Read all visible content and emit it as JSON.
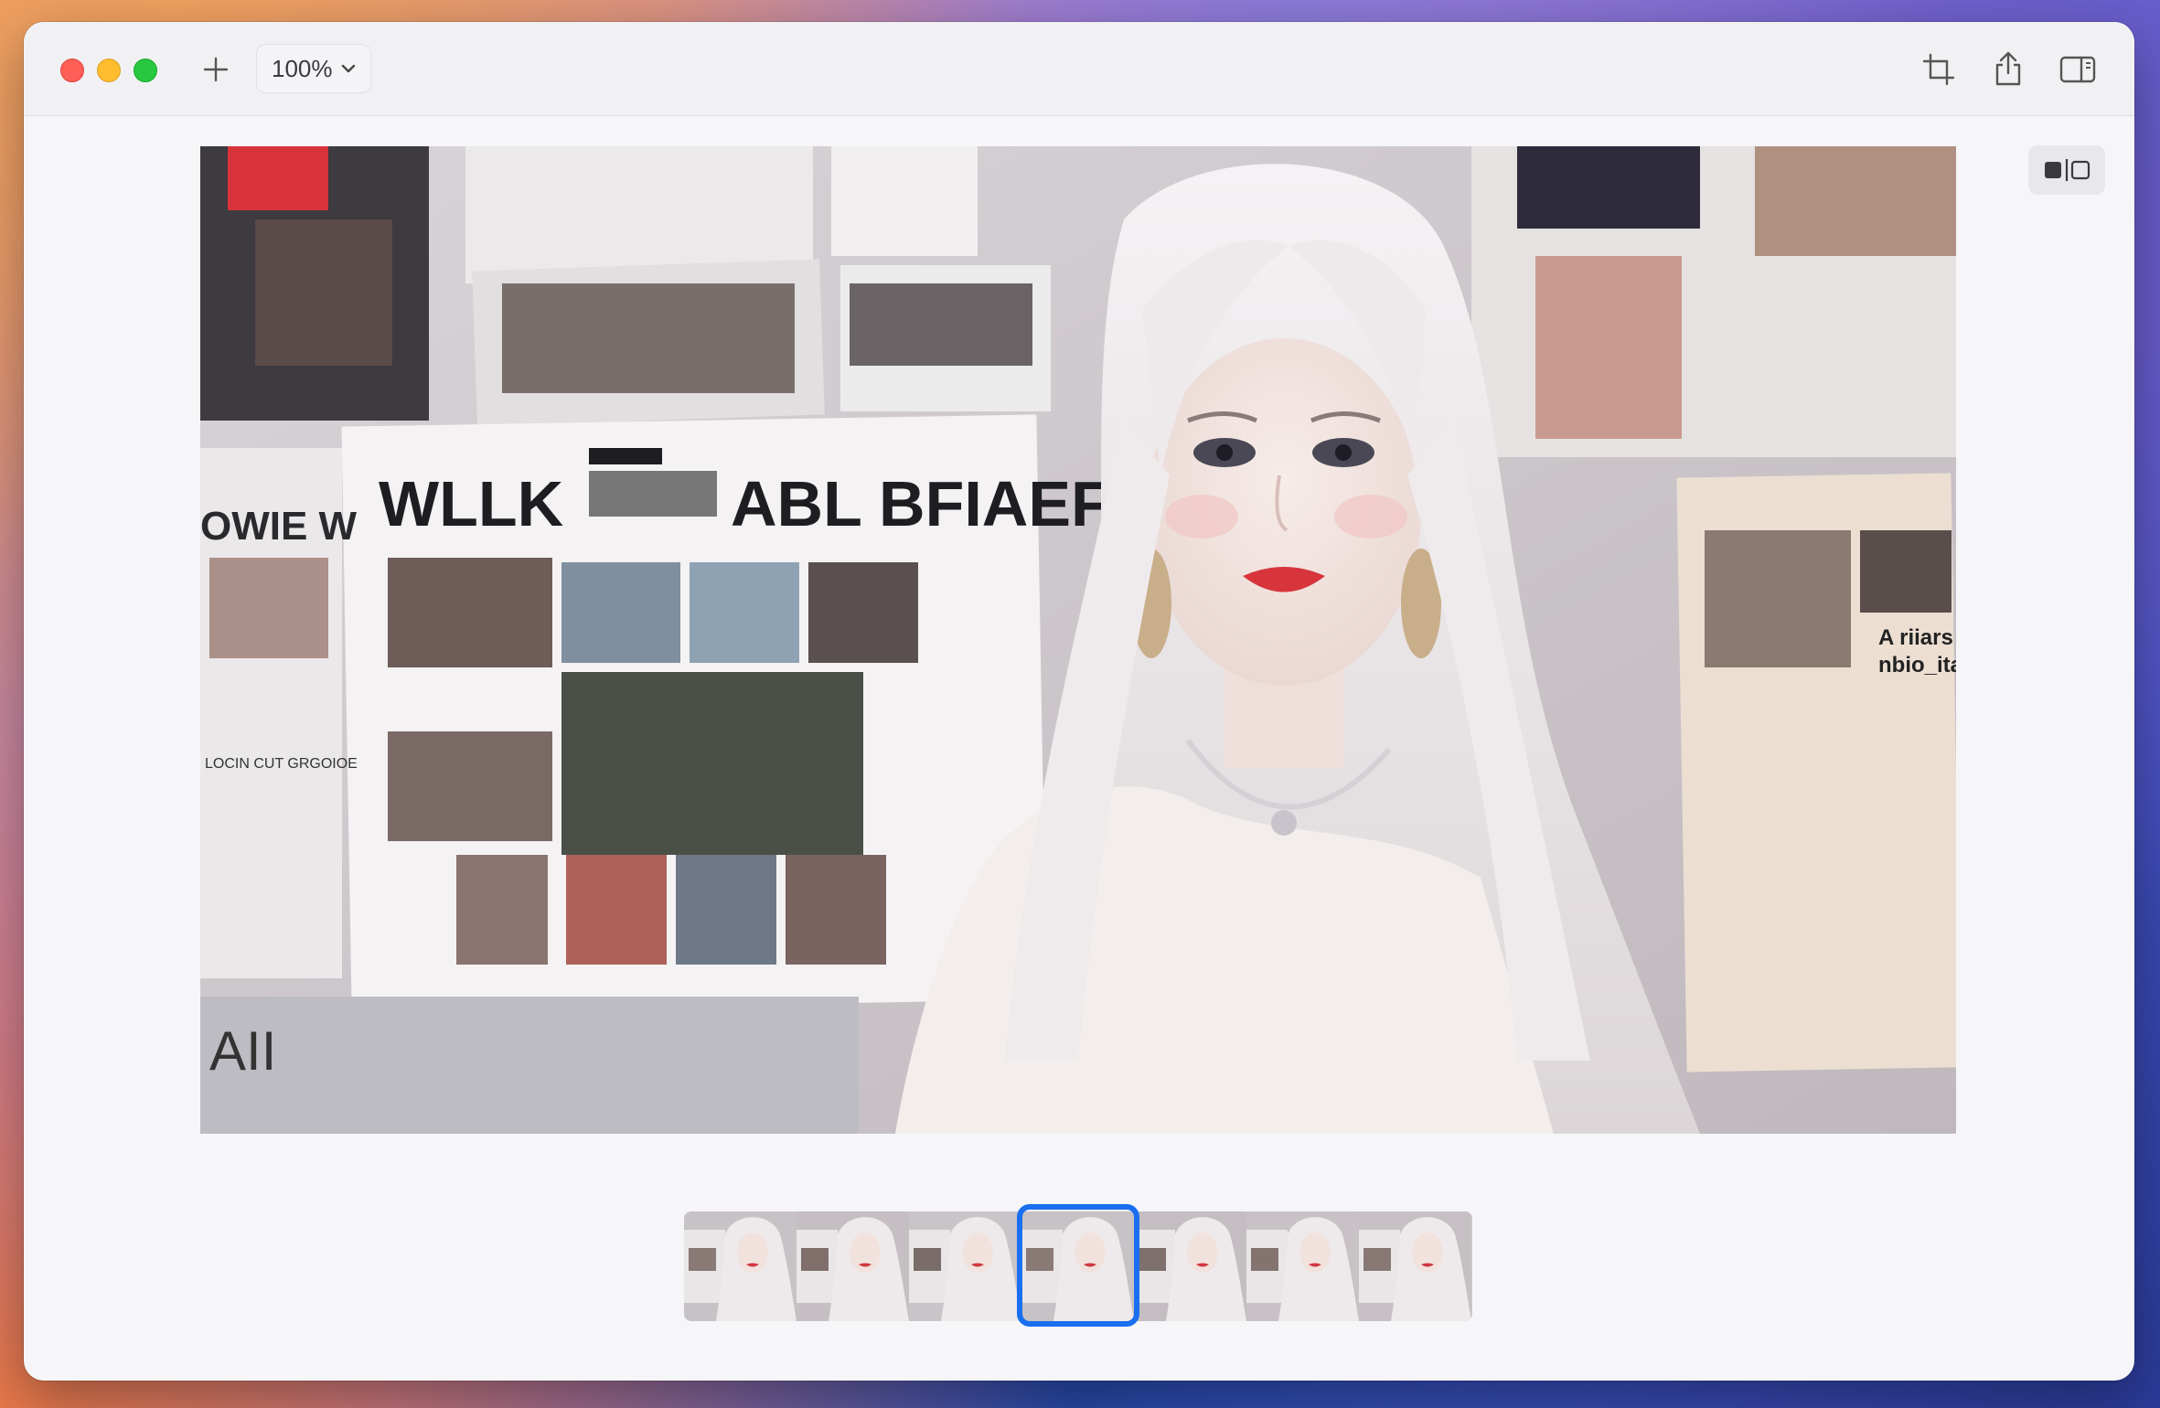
{
  "window": {
    "title": ""
  },
  "toolbar": {
    "new_tab_icon": "plus-icon",
    "zoom_label": "100%",
    "zoom_icon": "chevron-down-icon",
    "crop_icon": "crop-icon",
    "share_icon": "share-icon",
    "sidebar_icon": "sidebar-right-icon"
  },
  "viewer": {
    "compare_icon": "compare-split-icon",
    "headline_left": "WLLK",
    "headline_right": "ABL BFIAEF",
    "headline_side": "OWIE W",
    "side_text_1": "A riiars",
    "side_text_2": "nbio_itaF",
    "side_text_3": "LOCIN CUT GRGOIOE",
    "bottom_text": "AII"
  },
  "filmstrip": {
    "count": 7,
    "selected_index": 3,
    "selected_color": "#1a6ff0"
  },
  "colors": {
    "window_bg": "#f6f6f9",
    "toolbar_bg": "#f1f1f4",
    "close": "#fe5f57",
    "minimize": "#febc2e",
    "zoom": "#28c840"
  }
}
